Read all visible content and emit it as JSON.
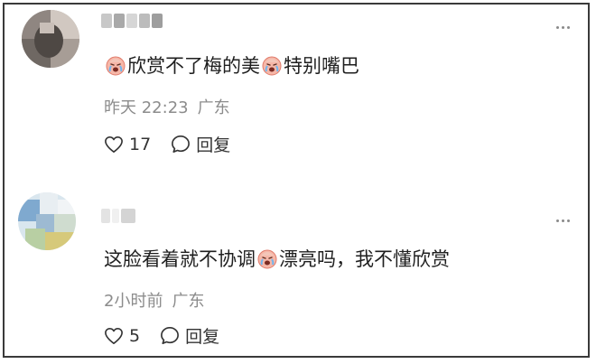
{
  "comments": [
    {
      "text_parts": [
        "",
        "欣赏不了梅的美",
        "特别嘴巴"
      ],
      "time": "昨天 22:23",
      "location": "广东",
      "likes": "17",
      "reply_label": "回复"
    },
    {
      "text_parts": [
        "这脸看着就不协调",
        "漂亮吗，我不懂欣赏"
      ],
      "time": "2小时前",
      "location": "广东",
      "likes": "5",
      "reply_label": "回复"
    }
  ],
  "icons": {
    "like": "heart-outline-icon",
    "reply": "speech-bubble-icon",
    "more": "more-dots-icon",
    "emoji": "crying-face-emoji"
  }
}
